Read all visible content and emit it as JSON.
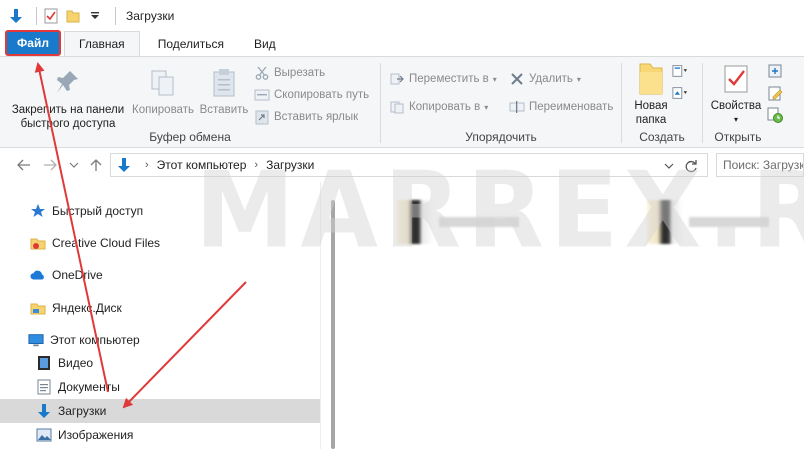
{
  "window": {
    "title": "Загрузки"
  },
  "tabs": [
    "Файл",
    "Главная",
    "Поделиться",
    "Вид"
  ],
  "ribbon": {
    "clipboard": {
      "label": "Буфер обмена",
      "pin": "Закрепить на панели быстрого доступа",
      "copy": "Копировать",
      "paste": "Вставить",
      "cut": "Вырезать",
      "copy_path": "Скопировать путь",
      "paste_shortcut": "Вставить ярлык"
    },
    "organize": {
      "label": "Упорядочить",
      "move_to": "Переместить в",
      "copy_to": "Копировать в",
      "delete": "Удалить",
      "rename": "Переименовать"
    },
    "create": {
      "label": "Создать",
      "new_folder": "Новая папка"
    },
    "open": {
      "label": "Открыть",
      "properties": "Свойства"
    }
  },
  "address": {
    "crumbs": [
      "Этот компьютер",
      "Загрузки"
    ],
    "search_placeholder": "Поиск: Загрузки"
  },
  "navpane": {
    "items": [
      {
        "label": "Быстрый доступ",
        "icon": "star-icon"
      },
      {
        "label": "Creative Cloud Files",
        "icon": "creative-cloud-icon"
      },
      {
        "label": "OneDrive",
        "icon": "cloud-icon"
      },
      {
        "label": "Яндекс.Диск",
        "icon": "yandex-disk-icon"
      },
      {
        "label": "Этот компьютер",
        "icon": "computer-icon"
      },
      {
        "label": "Видео",
        "icon": "video-icon"
      },
      {
        "label": "Документы",
        "icon": "documents-icon"
      },
      {
        "label": "Загрузки",
        "icon": "downloads-icon"
      },
      {
        "label": "Изображения",
        "icon": "pictures-icon"
      }
    ]
  },
  "watermark": "MARREX.RU",
  "colors": {
    "accent": "#1979ca",
    "annotation": "#e0393a",
    "selected": "#d9d9d9"
  }
}
